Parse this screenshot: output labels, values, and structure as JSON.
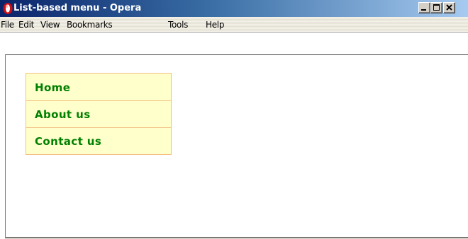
{
  "window": {
    "title": "List-based menu - Opera",
    "app_icon": "opera-logo-icon",
    "controls": {
      "minimize_icon": "minimize-icon",
      "maximize_icon": "maximize-icon",
      "close_icon": "close-icon"
    }
  },
  "menubar": {
    "items": [
      {
        "label": "File"
      },
      {
        "label": "Edit"
      },
      {
        "label": "View"
      },
      {
        "label": "Bookmarks"
      },
      {
        "label": "Tools"
      },
      {
        "label": "Help"
      }
    ]
  },
  "page": {
    "nav_menu": {
      "items": [
        {
          "label": "Home"
        },
        {
          "label": "About us"
        },
        {
          "label": "Contact us"
        }
      ],
      "colors": {
        "background": "#ffffcc",
        "border": "#f2c083",
        "text": "#008000"
      }
    }
  }
}
